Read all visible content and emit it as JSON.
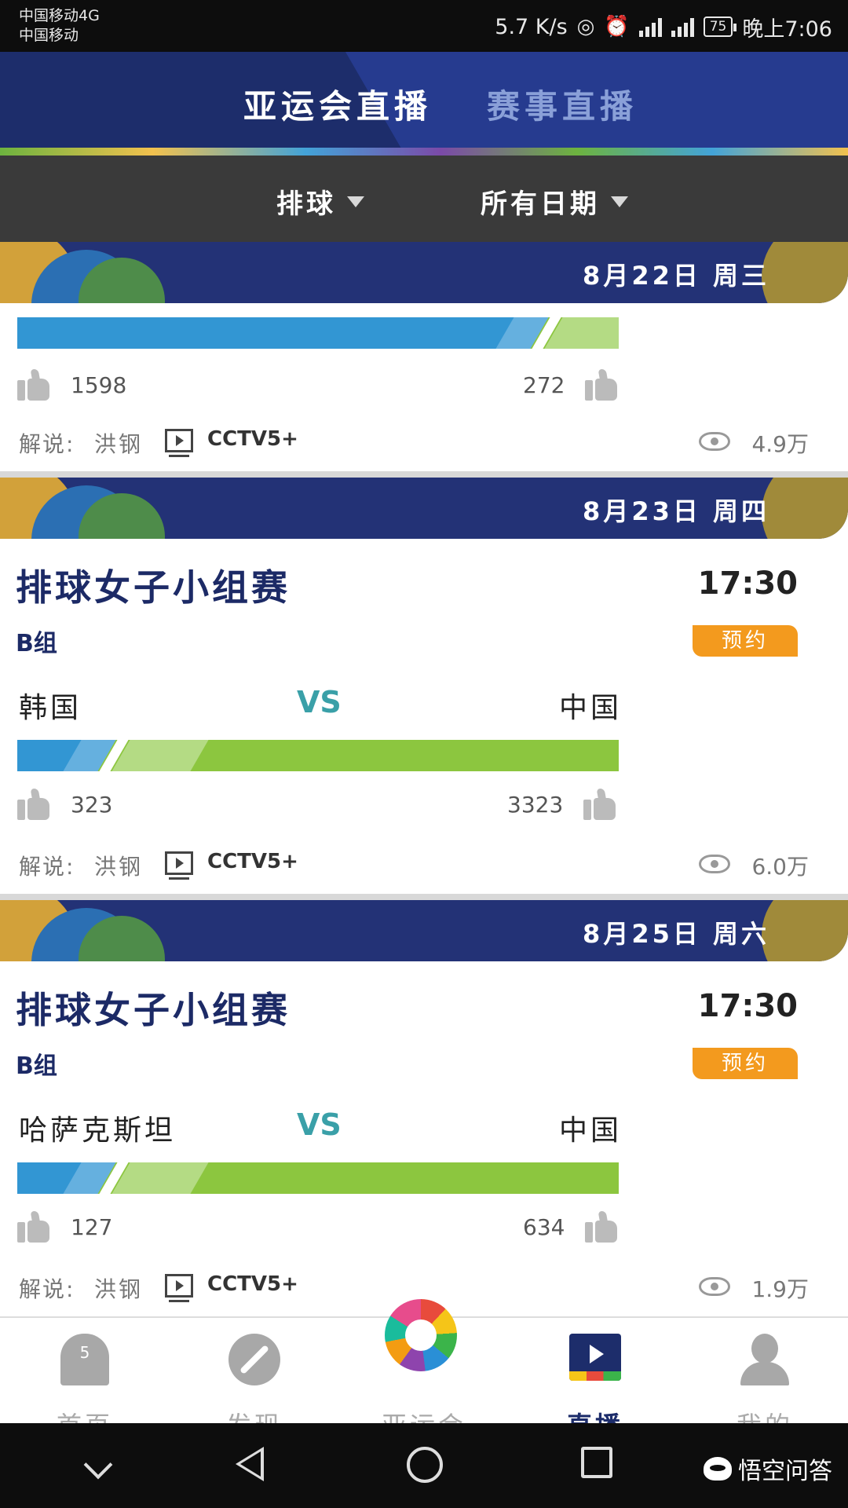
{
  "status_bar": {
    "carrier_1": "中国移动4G",
    "carrier_2": "中国移动",
    "speed": "5.7 K/s",
    "battery": "75",
    "time": "晚上7:06"
  },
  "tabs": [
    {
      "label": "亚运会直播",
      "active": true
    },
    {
      "label": "赛事直播",
      "active": false
    }
  ],
  "filters": {
    "sport": "排球",
    "date": "所有日期"
  },
  "matches": [
    {
      "date": "8月22日  周三",
      "bar_left_fraction": 0.84,
      "likes_left": "1598",
      "likes_right": "272",
      "commentary_label": "解说:",
      "commentator": "洪钢",
      "channel": "CCTV5+",
      "views": "4.9万"
    },
    {
      "date": "8月23日  周四",
      "title": "排球女子小组赛",
      "time": "17:30",
      "group": "B组",
      "reserve_label": "预约",
      "team_left": "韩国",
      "vs": "VS",
      "team_right": "中国",
      "bar_left_fraction": 0.12,
      "likes_left": "323",
      "likes_right": "3323",
      "commentary_label": "解说:",
      "commentator": "洪钢",
      "channel": "CCTV5+",
      "views": "6.0万"
    },
    {
      "date": "8月25日  周六",
      "title": "排球女子小组赛",
      "time": "17:30",
      "group": "B组",
      "reserve_label": "预约",
      "team_left": "哈萨克斯坦",
      "vs": "VS",
      "team_right": "中国",
      "bar_left_fraction": 0.12,
      "likes_left": "127",
      "likes_right": "634",
      "commentary_label": "解说:",
      "commentator": "洪钢",
      "channel": "CCTV5+",
      "views": "1.9万"
    }
  ],
  "bottom_nav": [
    {
      "label": "首页",
      "badge": "5",
      "icon": "home-icon"
    },
    {
      "label": "发现",
      "icon": "compass-icon"
    },
    {
      "label": "亚运会",
      "icon": "asian-games-logo"
    },
    {
      "label": "直播",
      "icon": "live-tv-icon",
      "active": true
    },
    {
      "label": "我的",
      "icon": "user-icon"
    }
  ],
  "watermark": "悟空问答",
  "colors": {
    "navy": "#1d2d6b",
    "banner": "#233276",
    "bar_blue": "#3296d3",
    "bar_green": "#8cc63f",
    "reserve_orange": "#f39a1e",
    "vs_teal": "#3aa0a8"
  }
}
